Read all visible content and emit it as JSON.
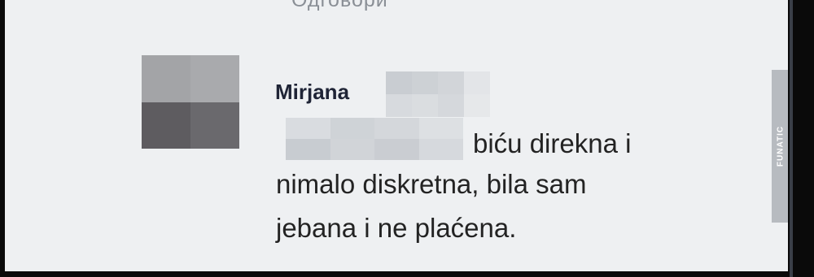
{
  "header": {
    "reply_label": "Одговори"
  },
  "comment": {
    "author": "Mirjana",
    "lines": [
      "biću direkna i",
      "nimalo diskretna, bila sam",
      "jebana i ne plaćena."
    ]
  },
  "watermark": {
    "text": "FUNATIC"
  },
  "colors": {
    "background": "#eef0f2",
    "author_text": "#1f2436",
    "body_text": "#232323",
    "frame": "#0a0a0a"
  },
  "icons": {
    "avatar": "pixelated-avatar",
    "redaction": "pixelated-blur"
  }
}
